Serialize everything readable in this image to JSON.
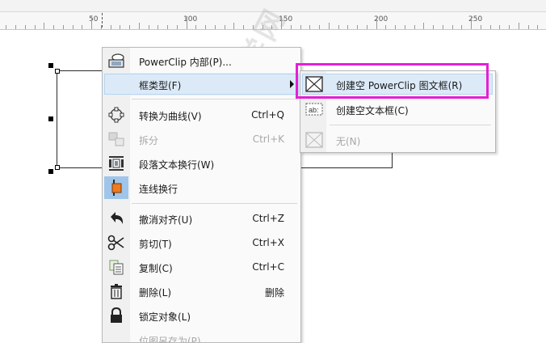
{
  "ruler": {
    "labels": [
      "50",
      "100",
      "150",
      "200",
      "250"
    ]
  },
  "watermark": {
    "text": "软件自学网",
    "sub": "WWW.RJZXW.COM"
  },
  "context_menu": {
    "items": [
      {
        "label": "PowerClip 内部(P)...",
        "shortcut": "",
        "icon": "powerclip-icon",
        "disabled": false
      },
      {
        "label": "框类型(F)",
        "shortcut": "",
        "icon": "",
        "disabled": false,
        "highlighted": true,
        "submenu": true
      },
      {
        "label": "转换为曲线(V)",
        "shortcut": "Ctrl+Q",
        "icon": "convert-curves-icon",
        "disabled": false
      },
      {
        "label": "拆分",
        "shortcut": "Ctrl+K",
        "icon": "break-apart-icon",
        "disabled": true
      },
      {
        "label": "段落文本换行(W)",
        "shortcut": "",
        "icon": "text-wrap-icon",
        "disabled": false
      },
      {
        "label": "连线换行",
        "shortcut": "",
        "icon": "connector-wrap-icon",
        "disabled": false
      },
      {
        "label": "撤消对齐(U)",
        "shortcut": "Ctrl+Z",
        "icon": "undo-icon",
        "disabled": false
      },
      {
        "label": "剪切(T)",
        "shortcut": "Ctrl+X",
        "icon": "scissors-icon",
        "disabled": false
      },
      {
        "label": "复制(C)",
        "shortcut": "Ctrl+C",
        "icon": "copy-icon",
        "disabled": false
      },
      {
        "label": "删除(L)",
        "shortcut": "删除",
        "icon": "trash-icon",
        "disabled": false
      },
      {
        "label": "锁定对象(L)",
        "shortcut": "",
        "icon": "lock-icon",
        "disabled": false
      },
      {
        "label": "位图另存为(P)...",
        "shortcut": "",
        "icon": "",
        "disabled": true
      }
    ]
  },
  "submenu": {
    "items": [
      {
        "label": "创建空 PowerClip 图文框(R)",
        "icon": "empty-frame-icon",
        "highlighted": true,
        "disabled": false
      },
      {
        "label": "创建空文本框(C)",
        "icon": "text-frame-icon",
        "disabled": false
      },
      {
        "label": "无(N)",
        "icon": "none-frame-icon",
        "disabled": true
      }
    ]
  },
  "colors": {
    "highlight": "#dceaf8",
    "annotation_box": "#e61fd5",
    "accent_orange": "#f07a1e"
  }
}
